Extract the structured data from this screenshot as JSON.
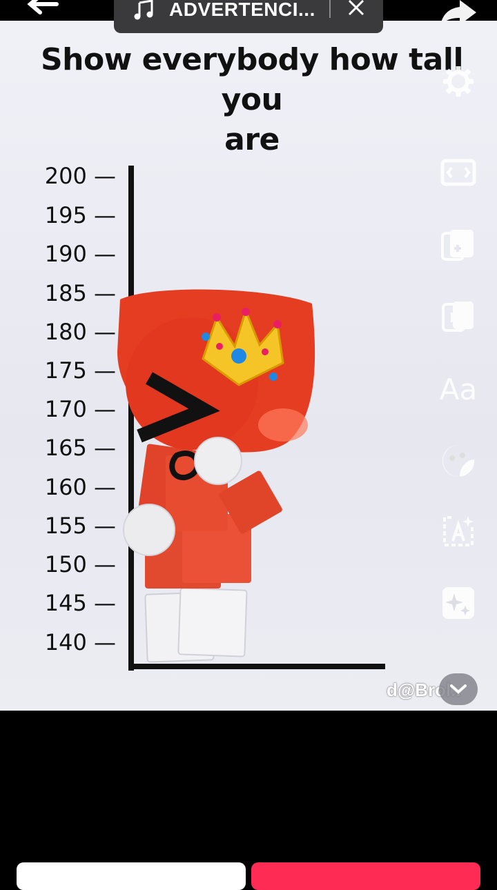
{
  "topbar": {
    "sound_title": "ADVERTENCI..."
  },
  "content": {
    "headline_line1": "Show everybody how tall you",
    "headline_line2": "are",
    "ruler_labels": [
      "200 —",
      "195 —",
      "190 —",
      "185 —",
      "180 —",
      "175 —",
      "170 —",
      "165 —",
      "160 —",
      "155 —",
      "150 —",
      "145 —",
      "140 —"
    ],
    "watermark": "d@Brol.."
  },
  "toolbar": {
    "text_tool_label": "Aa"
  },
  "colors": {
    "accent_red": "#e8452c",
    "bottom_right_button": "#fe2c55"
  }
}
